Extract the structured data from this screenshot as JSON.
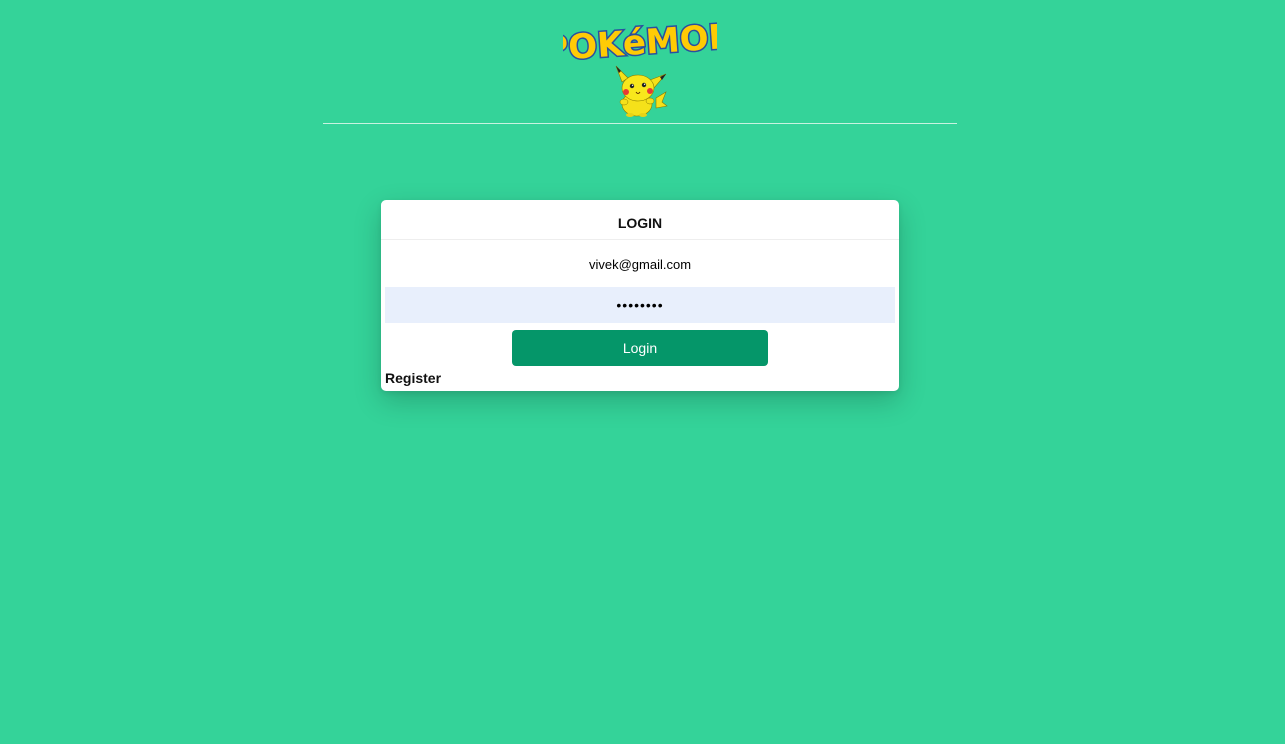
{
  "header": {
    "logo_text": "POKéMON",
    "mascot": "pikachu-icon"
  },
  "login_card": {
    "title": "LOGIN",
    "email_value": "vivek@gmail.com",
    "password_value": "••••••••",
    "login_label": "Login",
    "register_label": "Register"
  },
  "colors": {
    "background": "#34d399",
    "button": "#059669",
    "password_field_bg": "#e8effc",
    "logo_yellow": "#ffcb05",
    "logo_blue": "#2a4fa0"
  }
}
